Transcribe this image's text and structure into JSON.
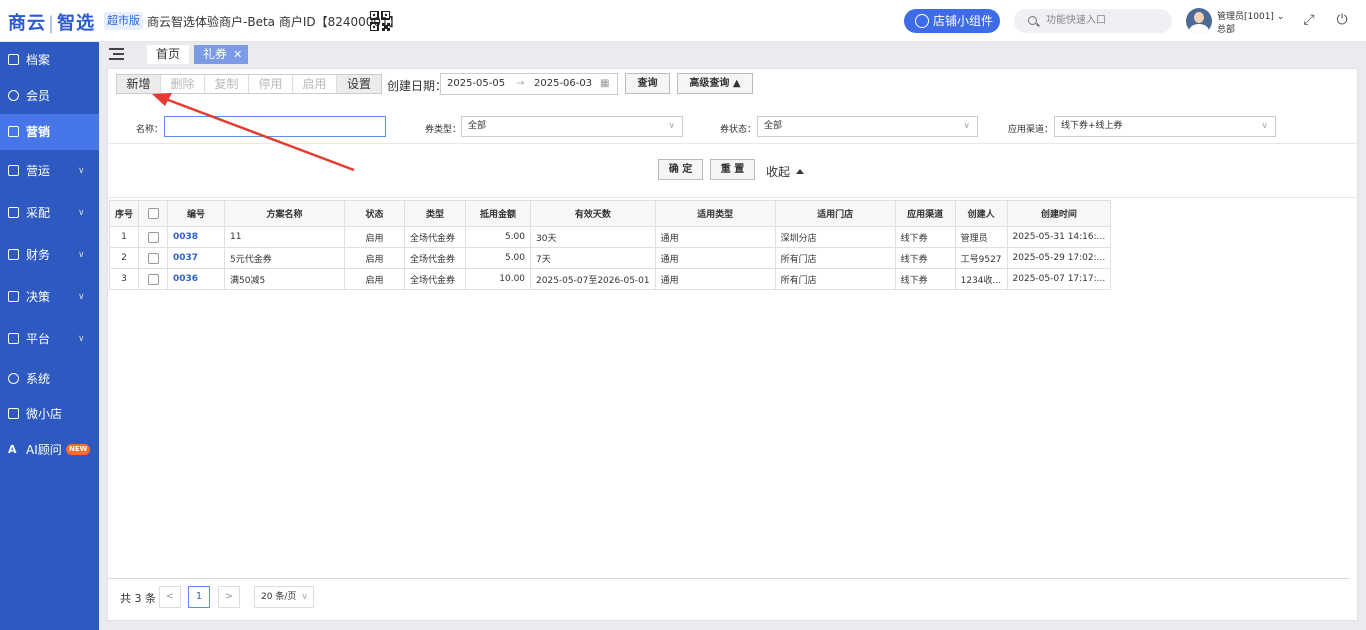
{
  "header": {
    "logo_left": "商云",
    "logo_right": "智选",
    "edition": "超市版",
    "merchant_text": "商云智选体验商户-Beta  商户ID【82400001】",
    "widget_button": "店铺小组件",
    "search_placeholder": "功能快速入口",
    "user_name": "管理员[1001]",
    "user_dept": "总部"
  },
  "sidebar": {
    "items": [
      {
        "label": "档案",
        "icon": "archive-icon"
      },
      {
        "label": "会员",
        "icon": "member-icon"
      },
      {
        "label": "营销",
        "icon": "marketing-icon"
      },
      {
        "label": "营运",
        "icon": "operations-icon"
      },
      {
        "label": "采配",
        "icon": "purchase-icon"
      },
      {
        "label": "财务",
        "icon": "finance-icon"
      },
      {
        "label": "决策",
        "icon": "decision-icon"
      },
      {
        "label": "平台",
        "icon": "platform-icon"
      },
      {
        "label": "系统",
        "icon": "system-icon"
      },
      {
        "label": "微小店",
        "icon": "store-icon"
      },
      {
        "label": "AI顾问",
        "icon": "ai-icon"
      }
    ],
    "new_badge": "NEW"
  },
  "tabs": {
    "home": "首页",
    "coupon": "礼券"
  },
  "toolbar": {
    "buttons": [
      "新增",
      "删除",
      "复制",
      "停用",
      "启用",
      "设置"
    ],
    "date_label": "创建日期：",
    "date_start": "2025-05-05",
    "date_end": "2025-06-03",
    "query": "查询",
    "advanced": "高级查询"
  },
  "filters": {
    "name_label": "名称：",
    "name_value": "",
    "type_label": "券类型：",
    "type_value": "全部",
    "status_label": "券状态：",
    "status_value": "全部",
    "channel_label": "应用渠道：",
    "channel_value": "线下券+线上券",
    "confirm": "确 定",
    "reset": "重 置",
    "collapse": "收起"
  },
  "table": {
    "columns": [
      "序号",
      "",
      "编号",
      "方案名称",
      "状态",
      "类型",
      "抵用金额",
      "有效天数",
      "适用类型",
      "适用门店",
      "应用渠道",
      "创建人",
      "创建时间"
    ],
    "rows": [
      [
        "1",
        "",
        "0038",
        "11",
        "启用",
        "全场代金券",
        "5.00",
        "30天",
        "通用",
        "深圳分店",
        "线下券",
        "管理员",
        "2025-05-31 14:16:..."
      ],
      [
        "2",
        "",
        "0037",
        "5元代金券",
        "启用",
        "全场代金券",
        "5.00",
        "7天",
        "通用",
        "所有门店",
        "线下券",
        "工号9527",
        "2025-05-29 17:02:..."
      ],
      [
        "3",
        "",
        "0036",
        "满50减5",
        "启用",
        "全场代金券",
        "10.00",
        "2025-05-07至2026-05-01",
        "通用",
        "所有门店",
        "线下券",
        "1234收...",
        "2025-05-07 17:17:..."
      ]
    ]
  },
  "pagination": {
    "total": "共 3 条",
    "prev": "<",
    "current": "1",
    "next": ">",
    "page_size": "20 条/页"
  },
  "colors": {
    "sidebar": "#2d59c0",
    "accent": "#3e6be6",
    "annotation_arrow": "#e53a2f"
  }
}
